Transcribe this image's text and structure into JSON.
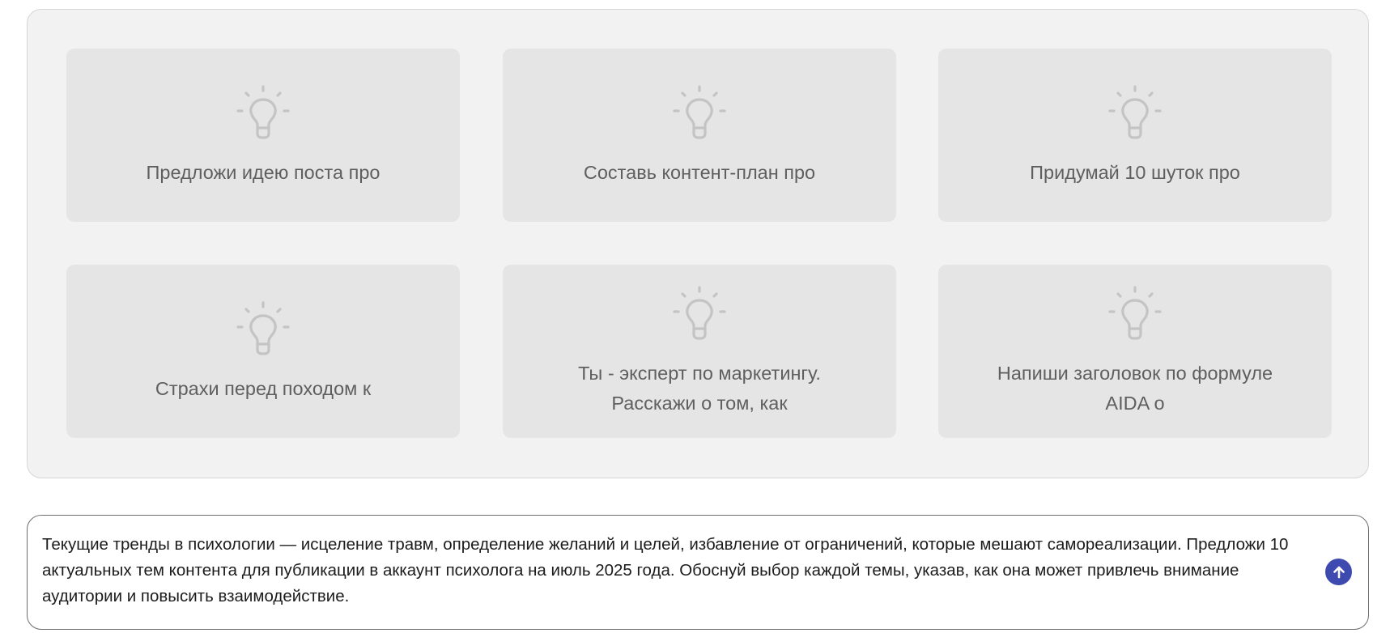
{
  "suggestions": [
    {
      "text": "Предложи идею поста про",
      "icon": "lightbulb-icon"
    },
    {
      "text": "Составь контент-план про",
      "icon": "lightbulb-icon"
    },
    {
      "text": "Придумай 10 шуток про",
      "icon": "lightbulb-icon"
    },
    {
      "text": "Страхи перед походом к",
      "icon": "lightbulb-icon"
    },
    {
      "text": "Ты - эксперт по маркетингу. Расскажи о том, как",
      "icon": "lightbulb-icon"
    },
    {
      "text": "Напиши заголовок по формуле AIDA о",
      "icon": "lightbulb-icon"
    }
  ],
  "prompt": {
    "value": "Текущие тренды в психологии — исцеление травм, определение желаний и целей, избавление от ограничений, которые мешают самореализации. Предложи 10 актуальных тем контента для публикации в аккаунт психолога на июль 2025 года. Обоснуй выбор каждой темы, указав, как она может привлечь внимание аудитории и повысить взаимодействие.",
    "send_icon": "arrow-up-icon"
  },
  "colors": {
    "panel_bg": "#f2f2f2",
    "card_bg": "#e5e5e5",
    "icon": "#c4c4c4",
    "send_button": "#3f4ab0"
  }
}
